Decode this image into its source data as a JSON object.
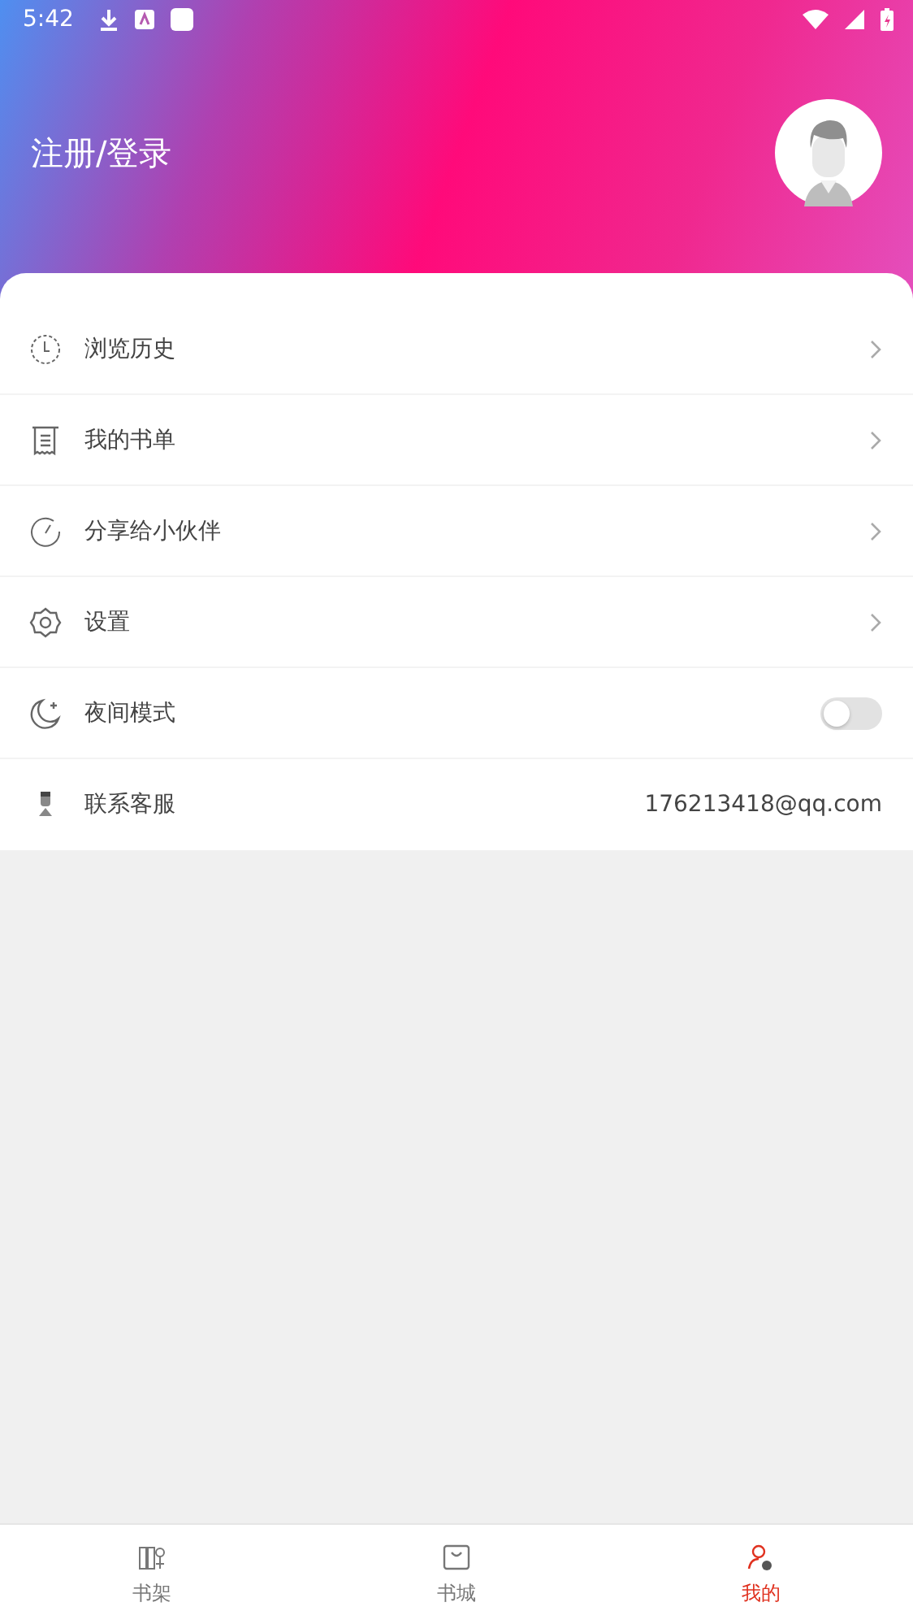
{
  "status_bar": {
    "time": "5:42"
  },
  "header": {
    "title": "注册/登录"
  },
  "menu": [
    {
      "kind": "link",
      "label": "浏览历史"
    },
    {
      "kind": "link",
      "label": "我的书单"
    },
    {
      "kind": "link",
      "label": "分享给小伙伴"
    },
    {
      "kind": "link",
      "label": "设置"
    },
    {
      "kind": "toggle",
      "label": "夜间模式",
      "on": false
    },
    {
      "kind": "info",
      "label": "联系客服",
      "value": "176213418@qq.com"
    }
  ],
  "tabs": [
    {
      "label": "书架",
      "selected": false
    },
    {
      "label": "书城",
      "selected": false
    },
    {
      "label": "我的",
      "selected": true
    }
  ]
}
